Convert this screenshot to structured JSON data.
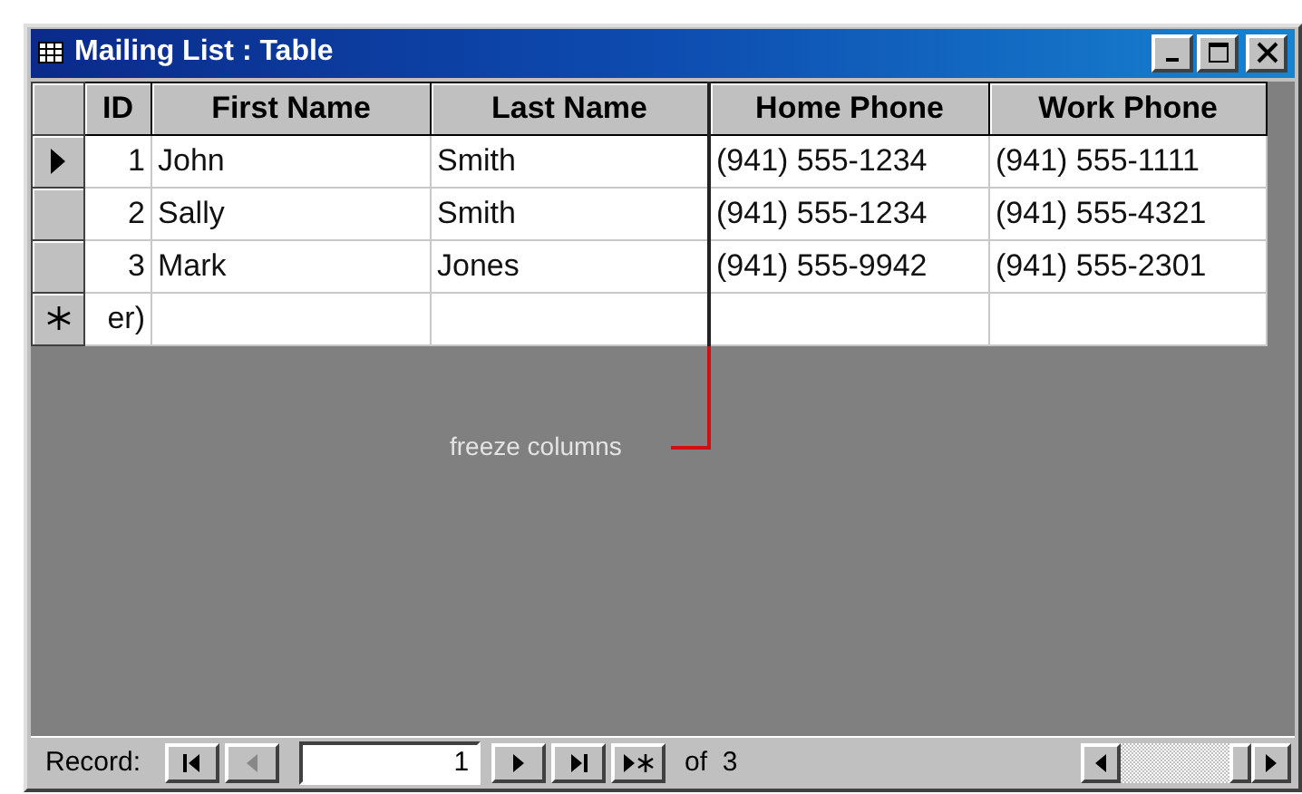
{
  "window": {
    "title": "Mailing List : Table"
  },
  "table": {
    "columns": [
      {
        "label": "ID",
        "frozen": false
      },
      {
        "label": "First Name",
        "frozen": false
      },
      {
        "label": "Last Name",
        "frozen": true
      },
      {
        "label": "Home Phone",
        "frozen": false
      },
      {
        "label": "Work Phone",
        "frozen": false
      }
    ],
    "rows": [
      {
        "kind": "record",
        "current": true,
        "cells": [
          "1",
          "John",
          "Smith",
          "(941) 555-1234",
          "(941) 555-1111"
        ]
      },
      {
        "kind": "record",
        "current": false,
        "cells": [
          "2",
          "Sally",
          "Smith",
          "(941) 555-1234",
          "(941) 555-4321"
        ]
      },
      {
        "kind": "record",
        "current": false,
        "cells": [
          "3",
          "Mark",
          "Jones",
          "(941) 555-9942",
          "(941) 555-2301"
        ]
      },
      {
        "kind": "new",
        "current": false,
        "cells": [
          "er)",
          "",
          "",
          "",
          ""
        ]
      }
    ]
  },
  "annotation": {
    "label": "freeze columns"
  },
  "navigation": {
    "label": "Record:",
    "value": "1",
    "total": "of  3",
    "buttons": [
      {
        "kind": "first",
        "disabled": false
      },
      {
        "kind": "previous",
        "disabled": true
      },
      {
        "kind": "next",
        "disabled": false
      },
      {
        "kind": "last",
        "disabled": false
      },
      {
        "kind": "new",
        "disabled": false
      }
    ]
  }
}
